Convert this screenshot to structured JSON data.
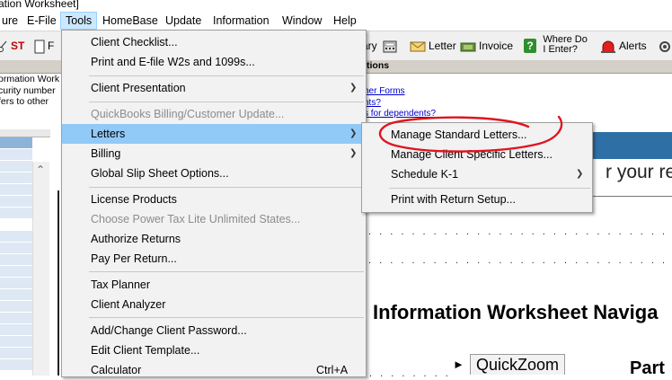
{
  "window": {
    "title_fragment": "ation Worksheet]"
  },
  "menubar": {
    "items": [
      "ure",
      "E-File",
      "Tools",
      "HomeBase",
      "Update",
      "Information",
      "Window",
      "Help"
    ]
  },
  "toolbar": {
    "st_label": "ST",
    "lary_label": "ary",
    "letter_label": "Letter",
    "invoice_label": "Invoice",
    "where_do_label_1": "Where Do",
    "where_do_label_2": "I Enter?",
    "alerts_label": "Alerts"
  },
  "band": {
    "label": "tions"
  },
  "left_info": {
    "lines": [
      "ormation Works",
      "curity number",
      "fers to other"
    ]
  },
  "links": {
    "items": [
      "her Forms",
      "nts?",
      "s for dependents?"
    ]
  },
  "document": {
    "partial_heading": "r your re",
    "nav_title": "Information Worksheet Naviga",
    "quickzoom_label": "QuickZoom",
    "part_label": "Part"
  },
  "tools_menu": {
    "items": [
      {
        "label": "Client Checklist...",
        "enabled": true
      },
      {
        "label": "Print and E-file W2s and 1099s...",
        "enabled": true
      },
      {
        "label": "Client Presentation",
        "enabled": true,
        "submenu": true
      },
      {
        "label": "QuickBooks Billing/Customer Update...",
        "enabled": false
      },
      {
        "label": "Letters",
        "enabled": true,
        "submenu": true,
        "highlighted": true
      },
      {
        "label": "Billing",
        "enabled": true,
        "submenu": true
      },
      {
        "label": "Global Slip Sheet Options...",
        "enabled": true
      },
      {
        "label": "License Products",
        "enabled": true
      },
      {
        "label": "Choose Power Tax Lite Unlimited States...",
        "enabled": false
      },
      {
        "label": "Authorize Returns",
        "enabled": true
      },
      {
        "label": "Pay Per Return...",
        "enabled": true
      },
      {
        "label": "Tax Planner",
        "enabled": true
      },
      {
        "label": "Client Analyzer",
        "enabled": true
      },
      {
        "label": "Add/Change Client Password...",
        "enabled": true
      },
      {
        "label": "Edit Client Template...",
        "enabled": true
      },
      {
        "label": "Calculator",
        "enabled": true,
        "shortcut": "Ctrl+A"
      }
    ]
  },
  "letters_submenu": {
    "items": [
      {
        "label": "Manage Standard Letters...",
        "submenu": false
      },
      {
        "label": "Manage Client Specific Letters...",
        "submenu": false
      },
      {
        "label": "Schedule K-1",
        "submenu": true
      },
      {
        "label": "Print with Return Setup...",
        "submenu": false
      }
    ]
  },
  "colors": {
    "menu_highlight": "#91c9f7",
    "annotation_red": "#e0141e",
    "doc_header_blue": "#2e6fa6"
  }
}
